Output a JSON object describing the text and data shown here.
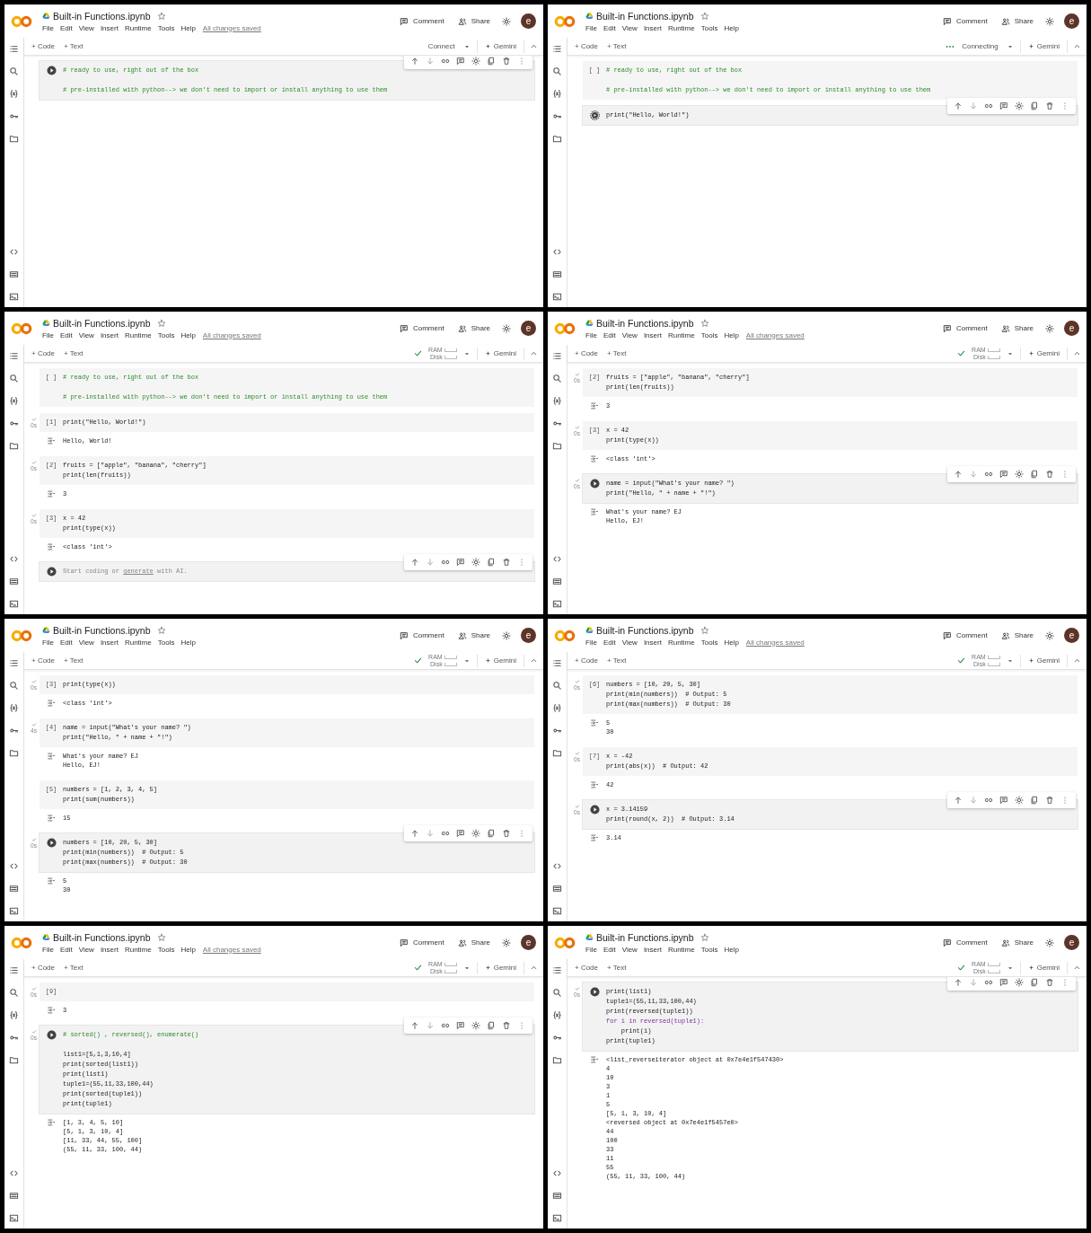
{
  "panels": [
    {
      "title": "Built-in Functions.ipynb",
      "menu": [
        "File",
        "Edit",
        "View",
        "Insert",
        "Runtime",
        "Tools",
        "Help"
      ],
      "save_status": "All changes saved",
      "comment": "Comment",
      "share": "Share",
      "avatar": "e",
      "add_code": "+ Code",
      "add_text": "+ Text",
      "runtime": {
        "kind": "connect",
        "label": "Connect"
      },
      "gemini": "Gemini",
      "cells": [
        {
          "kind": "run",
          "selected": true,
          "executed": false,
          "lines": [
            {
              "kind": "comment",
              "text": "# ready to use, right out of the box"
            },
            {
              "kind": "blank"
            },
            {
              "kind": "comment",
              "text": "# pre-installed with python--> we don't need to import or install anything to use them"
            }
          ]
        }
      ]
    },
    {
      "title": "Built-in Functions.ipynb",
      "menu": [
        "File",
        "Edit",
        "View",
        "Insert",
        "Runtime",
        "Tools",
        "Help"
      ],
      "comment": "Comment",
      "share": "Share",
      "avatar": "e",
      "add_code": "+ Code",
      "add_text": "+ Text",
      "runtime": {
        "kind": "connecting",
        "label": "Connecting"
      },
      "gemini": "Gemini",
      "cells": [
        {
          "prompt": "[ ]",
          "selected": false,
          "executed": false,
          "lines": [
            {
              "kind": "comment",
              "text": "# ready to use, right out of the box"
            },
            {
              "kind": "blank"
            },
            {
              "kind": "comment",
              "text": "# pre-installed with python--> we don't need to import or install anything to use them"
            }
          ]
        },
        {
          "kind": "running",
          "selected": true,
          "executed": false,
          "lines": [
            {
              "kind": "code",
              "text": "print(\"Hello, World!\")"
            }
          ]
        }
      ]
    },
    {
      "title": "Built-in Functions.ipynb",
      "menu": [
        "File",
        "Edit",
        "View",
        "Insert",
        "Runtime",
        "Tools",
        "Help"
      ],
      "save_status": "All changes saved",
      "comment": "Comment",
      "share": "Share",
      "avatar": "e",
      "add_code": "+ Code",
      "add_text": "+ Text",
      "runtime": {
        "kind": "connected",
        "ram": "RAM",
        "disk": "Disk"
      },
      "gemini": "Gemini",
      "cells": [
        {
          "prompt": "[ ]",
          "selected": false,
          "executed": false,
          "lines": [
            {
              "kind": "comment",
              "text": "# ready to use, right out of the box"
            },
            {
              "kind": "blank"
            },
            {
              "kind": "comment",
              "text": "# pre-installed with python--> we don't need to import or install anything to use them"
            }
          ]
        },
        {
          "prompt": "[1]",
          "selected": false,
          "executed": true,
          "time": "0s",
          "lines": [
            {
              "kind": "code",
              "text": "print(\"Hello, World!\")"
            }
          ],
          "output": [
            "Hello, World!"
          ]
        },
        {
          "prompt": "[2]",
          "selected": false,
          "executed": true,
          "time": "0s",
          "lines": [
            {
              "kind": "code",
              "text": "fruits = [\"apple\", \"banana\", \"cherry\"]"
            },
            {
              "kind": "code",
              "text": "print(len(fruits))"
            }
          ],
          "output": [
            "3"
          ]
        },
        {
          "prompt": "[3]",
          "selected": false,
          "executed": true,
          "time": "0s",
          "lines": [
            {
              "kind": "code",
              "text": "x = 42"
            },
            {
              "kind": "code",
              "text": "print(type(x))"
            }
          ],
          "output": [
            "<class 'int'>"
          ]
        },
        {
          "kind": "run",
          "selected": true,
          "executed": false,
          "placeholder": {
            "before": "Start coding or",
            "link": "generate",
            "after": "with AI."
          }
        }
      ]
    },
    {
      "title": "Built-in Functions.ipynb",
      "menu": [
        "File",
        "Edit",
        "View",
        "Insert",
        "Runtime",
        "Tools",
        "Help"
      ],
      "save_status": "All changes saved",
      "comment": "Comment",
      "share": "Share",
      "avatar": "e",
      "add_code": "+ Code",
      "add_text": "+ Text",
      "runtime": {
        "kind": "connected",
        "ram": "RAM",
        "disk": "Disk"
      },
      "gemini": "Gemini",
      "cells": [
        {
          "prompt": "[2]",
          "selected": false,
          "executed": true,
          "time": "0s",
          "lines": [
            {
              "kind": "code",
              "text": "fruits = [\"apple\", \"banana\", \"cherry\"]"
            },
            {
              "kind": "code",
              "text": "print(len(fruits))"
            }
          ],
          "output": [
            "3"
          ]
        },
        {
          "prompt": "[3]",
          "selected": false,
          "executed": true,
          "time": "0s",
          "lines": [
            {
              "kind": "code",
              "text": "x = 42"
            },
            {
              "kind": "code",
              "text": "print(type(x))"
            }
          ],
          "output": [
            "<class 'int'>"
          ]
        },
        {
          "kind": "run",
          "selected": true,
          "executed": true,
          "time": "0s",
          "lines": [
            {
              "kind": "code",
              "text": "name = input(\"What's your name? \")"
            },
            {
              "kind": "code",
              "text": "print(\"Hello, \" + name + \"!\")"
            }
          ],
          "output": [
            "What's your name? EJ",
            "Hello, EJ!"
          ]
        }
      ]
    },
    {
      "title": "Built-in Functions.ipynb",
      "menu": [
        "File",
        "Edit",
        "View",
        "Insert",
        "Runtime",
        "Tools",
        "Help"
      ],
      "comment": "Comment",
      "share": "Share",
      "avatar": "e",
      "add_code": "+ Code",
      "add_text": "+ Text",
      "runtime": {
        "kind": "connected",
        "ram": "RAM",
        "disk": "Disk"
      },
      "gemini": "Gemini",
      "cells": [
        {
          "prompt": "[3]",
          "selected": false,
          "executed": true,
          "time": "0s",
          "lines": [
            {
              "kind": "code",
              "text": "print(type(x))"
            }
          ],
          "output": [
            "<class 'int'>"
          ]
        },
        {
          "prompt": "[4]",
          "selected": false,
          "executed": true,
          "time": "4s",
          "lines": [
            {
              "kind": "code",
              "text": "name = input(\"What's your name? \")"
            },
            {
              "kind": "code",
              "text": "print(\"Hello, \" + name + \"!\")"
            }
          ],
          "output": [
            "What's your name? EJ",
            "Hello, EJ!"
          ]
        },
        {
          "prompt": "[5]",
          "selected": false,
          "executed": false,
          "lines": [
            {
              "kind": "code",
              "text": "numbers = [1, 2, 3, 4, 5]"
            },
            {
              "kind": "code",
              "text": "print(sum(numbers))"
            }
          ],
          "output": [
            "15"
          ]
        },
        {
          "kind": "run",
          "selected": true,
          "executed": true,
          "time": "0s",
          "lines": [
            {
              "kind": "code",
              "text": "numbers = [10, 20, 5, 30]"
            },
            {
              "kind": "code",
              "text": "print(min(numbers))  # Output: 5"
            },
            {
              "kind": "code",
              "text": "print(max(numbers))  # Output: 30"
            }
          ],
          "output": [
            "5",
            "30"
          ]
        }
      ]
    },
    {
      "title": "Built-in Functions.ipynb",
      "menu": [
        "File",
        "Edit",
        "View",
        "Insert",
        "Runtime",
        "Tools",
        "Help"
      ],
      "save_status": "All changes saved",
      "comment": "Comment",
      "share": "Share",
      "avatar": "e",
      "add_code": "+ Code",
      "add_text": "+ Text",
      "runtime": {
        "kind": "connected",
        "ram": "RAM",
        "disk": "Disk"
      },
      "gemini": "Gemini",
      "cells": [
        {
          "prompt": "[6]",
          "selected": false,
          "executed": true,
          "time": "0s",
          "lines": [
            {
              "kind": "code",
              "text": "numbers = [10, 20, 5, 30]"
            },
            {
              "kind": "code",
              "text": "print(min(numbers))  # Output: 5"
            },
            {
              "kind": "code",
              "text": "print(max(numbers))  # Output: 30"
            }
          ],
          "output": [
            "5",
            "30"
          ]
        },
        {
          "prompt": "[7]",
          "selected": false,
          "executed": true,
          "time": "0s",
          "lines": [
            {
              "kind": "code",
              "text": "x = -42"
            },
            {
              "kind": "code",
              "text": "print(abs(x))  # Output: 42"
            }
          ],
          "output": [
            "42"
          ]
        },
        {
          "kind": "run",
          "selected": true,
          "executed": true,
          "time": "0s",
          "lines": [
            {
              "kind": "code",
              "text": "x = 3.14159"
            },
            {
              "kind": "code",
              "text": "print(round(x, 2))  # Output: 3.14"
            }
          ],
          "output": [
            "3.14"
          ]
        }
      ]
    },
    {
      "title": "Built-in Functions.ipynb",
      "menu": [
        "File",
        "Edit",
        "View",
        "Insert",
        "Runtime",
        "Tools",
        "Help"
      ],
      "save_status": "All changes saved",
      "comment": "Comment",
      "share": "Share",
      "avatar": "e",
      "add_code": "+ Code",
      "add_text": "+ Text",
      "runtime": {
        "kind": "connected",
        "ram": "RAM",
        "disk": "Disk"
      },
      "gemini": "Gemini",
      "cells": [
        {
          "kind": "numbered",
          "prompt": "[9]",
          "selected": false,
          "executed": true,
          "time": "0s",
          "output": [
            "3"
          ]
        },
        {
          "kind": "run",
          "selected": true,
          "executed": true,
          "time": "0s",
          "lines": [
            {
              "kind": "comment",
              "text": "# sorted() , reversed(), enumerate()"
            },
            {
              "kind": "blank"
            },
            {
              "kind": "code",
              "text": "list1=[5,1,3,10,4]"
            },
            {
              "kind": "code",
              "text": "print(sorted(list1))"
            },
            {
              "kind": "code",
              "text": "print(list1)"
            },
            {
              "kind": "code",
              "text": "tuple1=(55,11,33,100,44)"
            },
            {
              "kind": "code",
              "text": "print(sorted(tuple1))"
            },
            {
              "kind": "code",
              "text": "print(tuple1)"
            }
          ],
          "output": [
            "[1, 3, 4, 5, 10]",
            "[5, 1, 3, 10, 4]",
            "[11, 33, 44, 55, 100]",
            "(55, 11, 33, 100, 44)"
          ]
        }
      ]
    },
    {
      "title": "Built-in Functions.ipynb",
      "menu": [
        "File",
        "Edit",
        "View",
        "Insert",
        "Runtime",
        "Tools",
        "Help"
      ],
      "comment": "Comment",
      "share": "Share",
      "avatar": "e",
      "add_code": "+ Code",
      "add_text": "+ Text",
      "runtime": {
        "kind": "connected",
        "ram": "RAM",
        "disk": "Disk"
      },
      "gemini": "Gemini",
      "cells": [
        {
          "kind": "run",
          "selected": true,
          "executed": true,
          "time": "0s",
          "lines": [
            {
              "kind": "code",
              "text": "print(list1)"
            },
            {
              "kind": "code",
              "text": "tuple1=(55,11,33,100,44)"
            },
            {
              "kind": "code",
              "text": "print(reversed(tuple1))"
            },
            {
              "kind": "keyword",
              "text": "for i in reversed(tuple1):"
            },
            {
              "kind": "code",
              "text": "    print(i)"
            },
            {
              "kind": "code",
              "text": "print(tuple1)"
            }
          ],
          "output": [
            "<list_reverseiterator object at 0x7e4e1f547430>",
            "4",
            "10",
            "3",
            "1",
            "5",
            "[5, 1, 3, 10, 4]",
            "<reversed object at 0x7e4e1f5457e0>",
            "44",
            "100",
            "33",
            "11",
            "55",
            "(55, 11, 33, 100, 44)"
          ]
        }
      ]
    }
  ]
}
